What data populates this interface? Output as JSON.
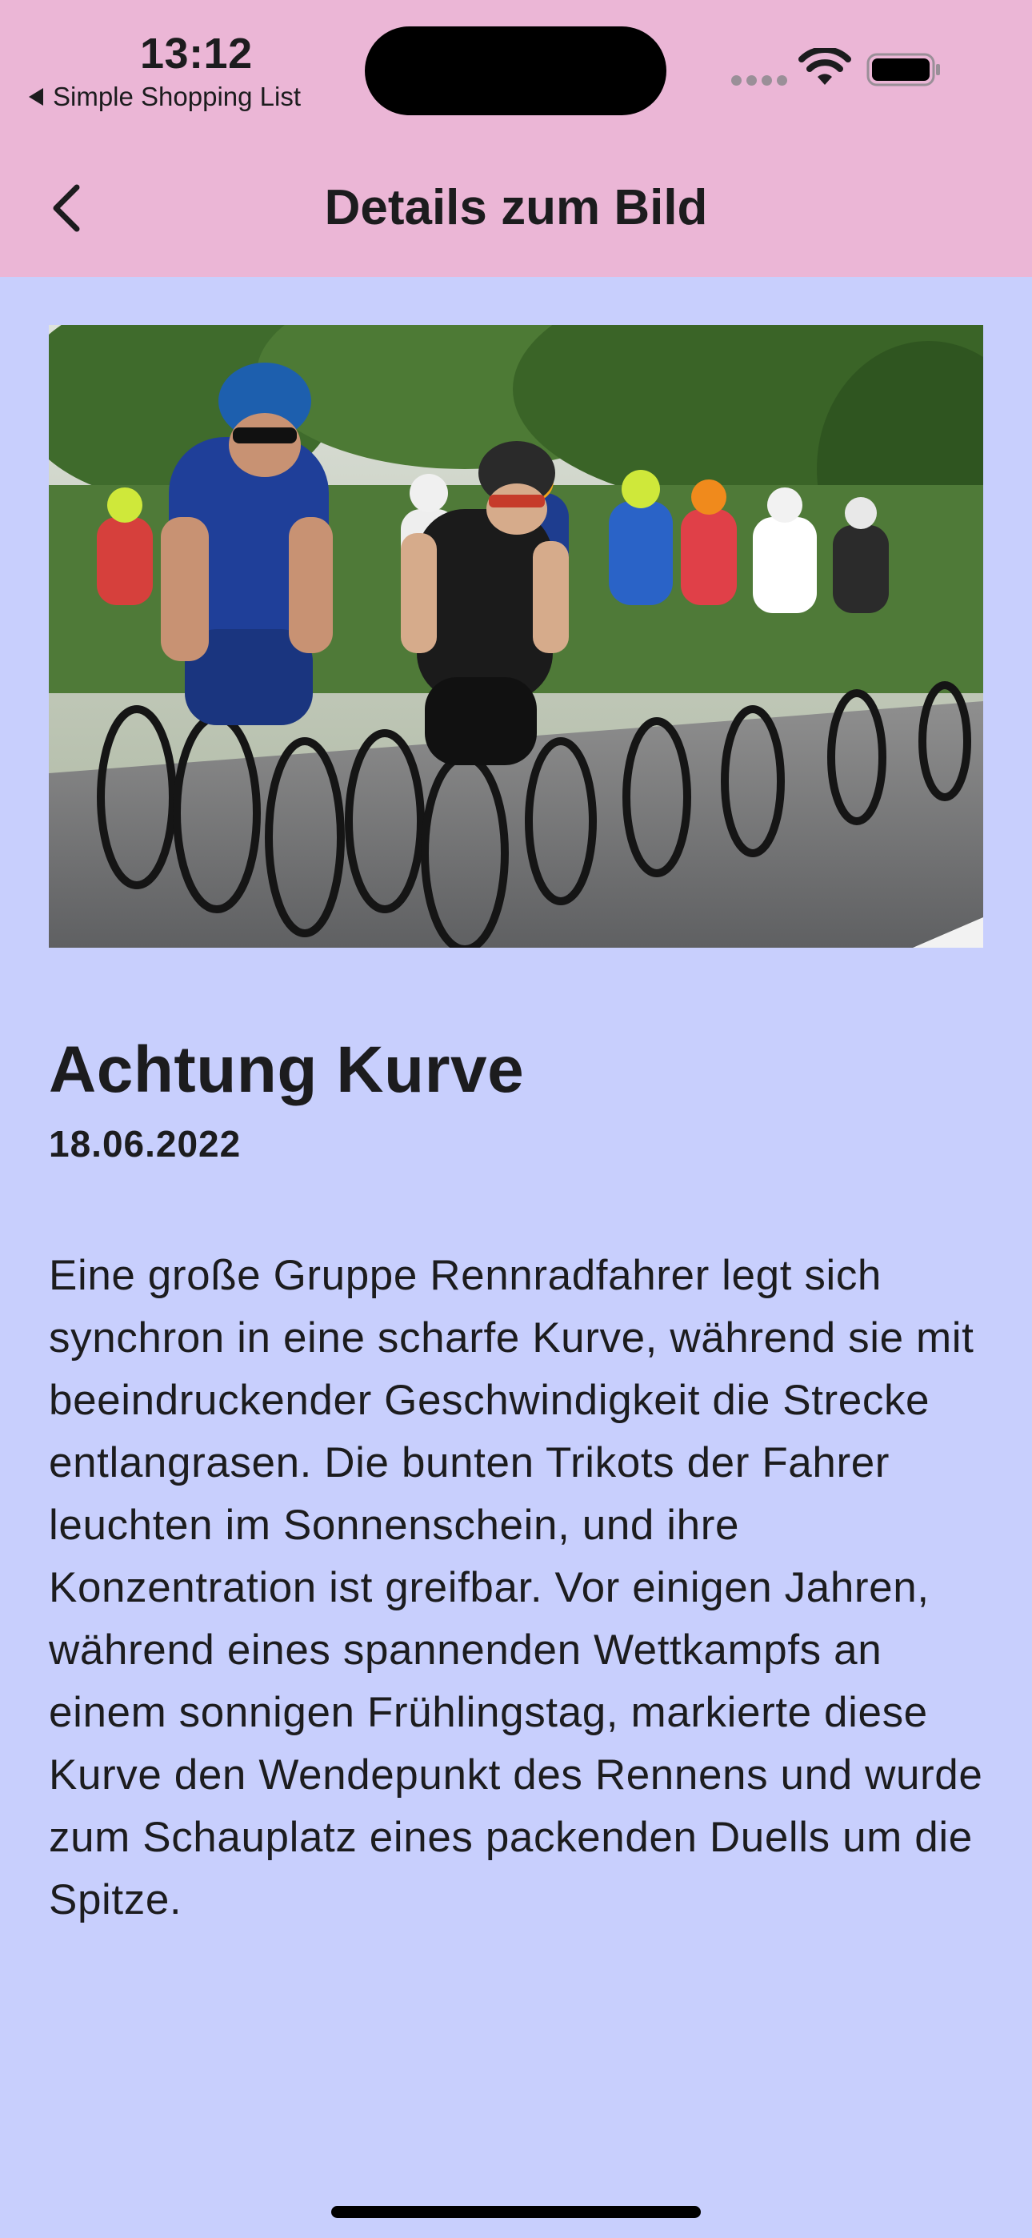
{
  "status_bar": {
    "time": "13:12",
    "back_app_label": "Simple Shopping List",
    "signal_icon": "cellular-signal-icon",
    "wifi_icon": "wifi-icon",
    "battery_icon": "battery-icon"
  },
  "nav": {
    "back_icon": "chevron-left-icon",
    "title": "Details zum Bild"
  },
  "image": {
    "subject": "peloton of road cyclists leaning into a curve"
  },
  "content": {
    "title": "Achtung Kurve",
    "date": "18.06.2022",
    "description": "Eine große Gruppe Rennradfahrer legt sich synchron in eine scharfe Kurve, während sie mit beeindruckender Geschwindigkeit die Strecke entlangrasen. Die bunten Trikots der Fahrer leuchten im Sonnenschein, und ihre Konzentration ist greifbar. Vor einigen Jahren, während eines spannenden Wettkampfs an einem sonnigen Frühlingstag, markierte diese Kurve den Wendepunkt des Rennens und wurde zum Schauplatz eines packenden Duells um die Spitze."
  },
  "colors": {
    "header_background": "#ebb6d6",
    "page_background": "#c8cffd",
    "text": "#1c1c1e"
  }
}
